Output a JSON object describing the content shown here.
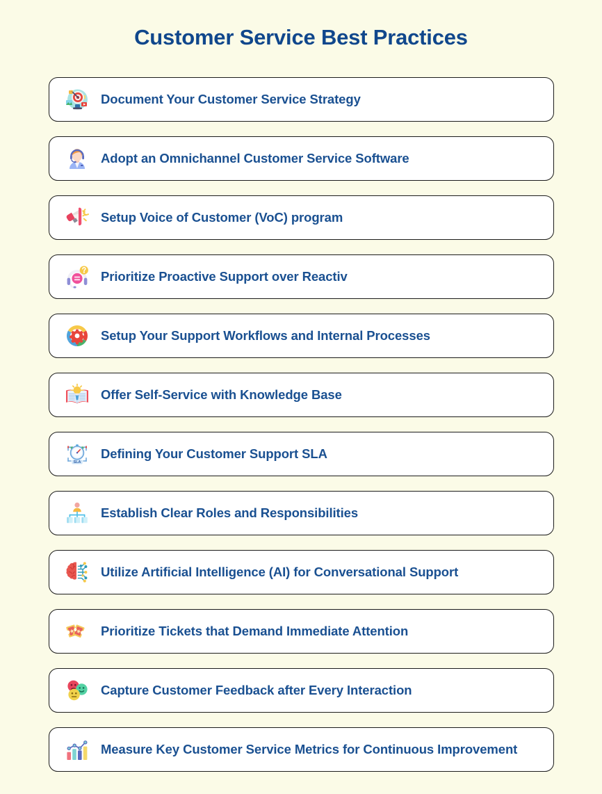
{
  "page": {
    "title": "Customer Service Best Practices",
    "background_color": "#FBFBE7",
    "title_color": "#10478C",
    "item_text_color": "#1A5091",
    "card_background": "#FFFFFF",
    "card_border_color": "#1B1B1B"
  },
  "items": [
    {
      "label": "Document Your Customer Service Strategy",
      "icon": "target-dartboard-icon"
    },
    {
      "label": "Adopt an Omnichannel Customer Service Software",
      "icon": "support-agent-headset-icon"
    },
    {
      "label": "Setup Voice of Customer (VoC) program",
      "icon": "megaphone-icon"
    },
    {
      "label": "Prioritize Proactive Support over Reactiv",
      "icon": "headset-question-icon"
    },
    {
      "label": "Setup Your Support Workflows and Internal Processes",
      "icon": "gear-workflow-icon"
    },
    {
      "label": "Offer Self-Service with Knowledge Base",
      "icon": "open-book-lightbulb-icon"
    },
    {
      "label": "Defining Your Customer Support SLA",
      "icon": "sla-stopwatch-icon"
    },
    {
      "label": "Establish Clear Roles and Responsibilities",
      "icon": "org-chart-icon"
    },
    {
      "label": "Utilize Artificial Intelligence (AI) for Conversational Support",
      "icon": "ai-brain-circuit-icon"
    },
    {
      "label": "Prioritize Tickets that Demand Immediate Attention",
      "icon": "tickets-icon"
    },
    {
      "label": "Capture Customer Feedback after Every Interaction",
      "icon": "feedback-smileys-icon"
    },
    {
      "label": "Measure Key Customer Service Metrics for Continuous Improvement",
      "icon": "bar-chart-metrics-icon"
    }
  ]
}
